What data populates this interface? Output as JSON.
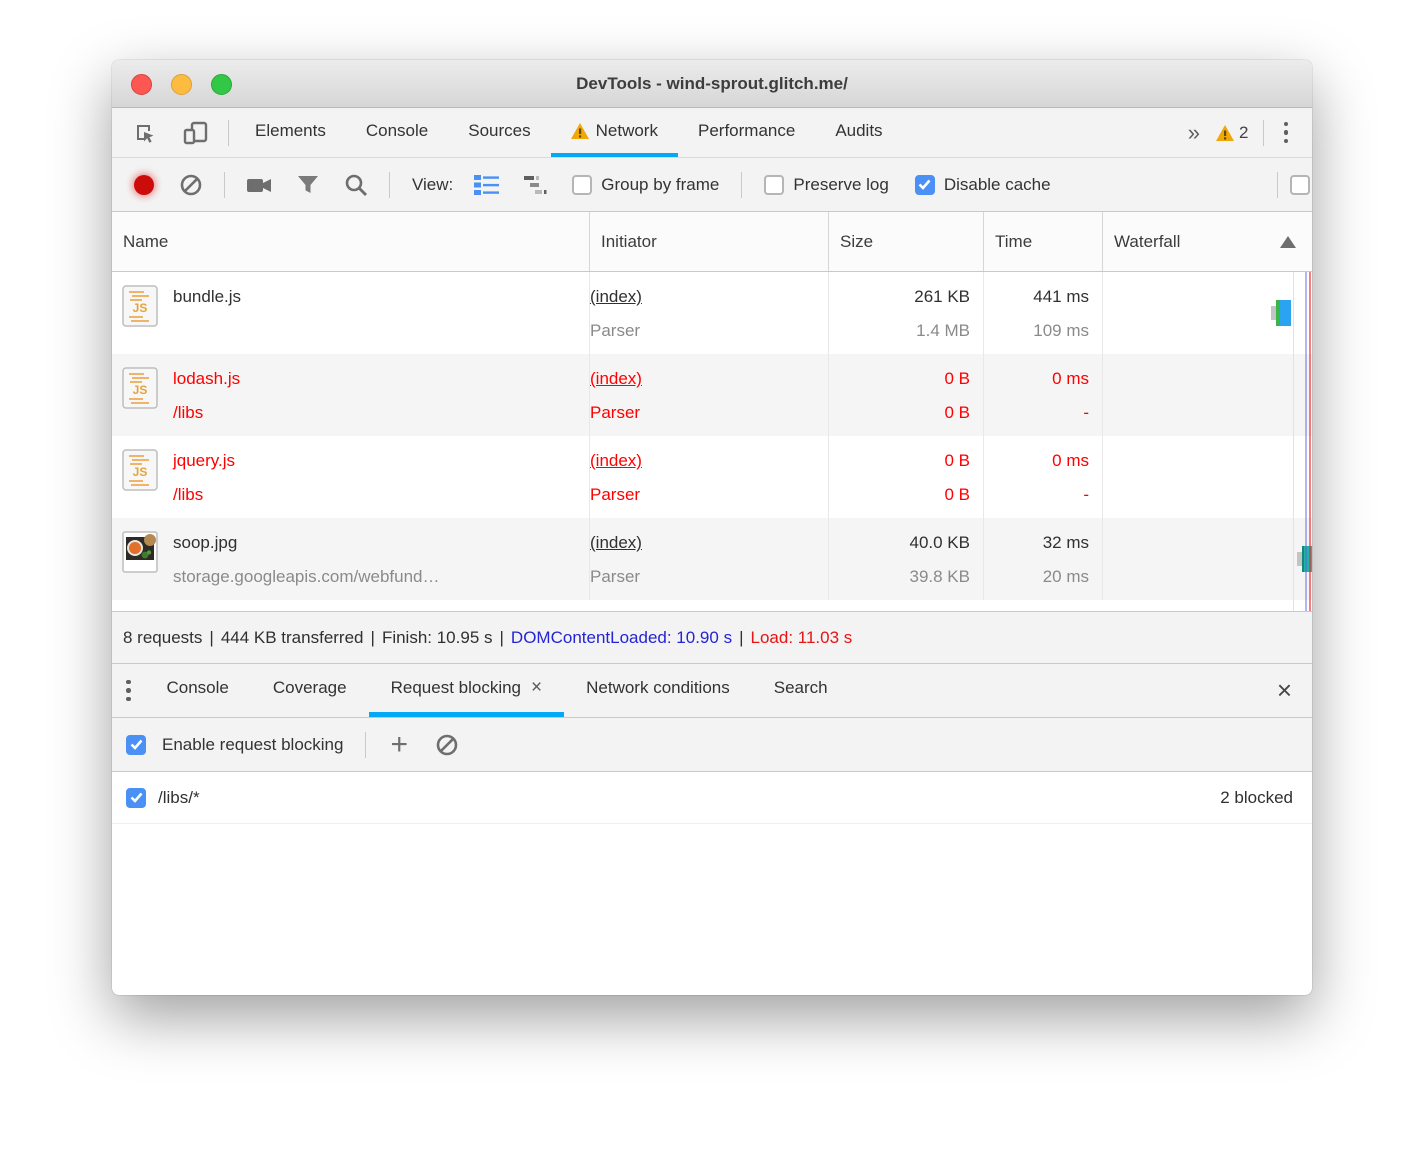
{
  "window_title": "DevTools - wind-sprout.glitch.me/",
  "main_tabs": {
    "elements": "Elements",
    "console": "Console",
    "sources": "Sources",
    "network": "Network",
    "performance": "Performance",
    "audits": "Audits",
    "warning_badge": "2"
  },
  "icons": {
    "overflow_chevron": "»",
    "close": "×",
    "add": "+",
    "kebab": "⋮"
  },
  "toolbar": {
    "view_label": "View:",
    "group_by_frame": "Group by frame",
    "preserve_log": "Preserve log",
    "disable_cache": "Disable cache"
  },
  "table": {
    "headers": {
      "name": "Name",
      "initiator": "Initiator",
      "size": "Size",
      "time": "Time",
      "waterfall": "Waterfall"
    },
    "rows": [
      {
        "name": "bundle.js",
        "subname": "",
        "initiator": "(index)",
        "initiator_sub": "Parser",
        "size": "261 KB",
        "size_sub": "1.4 MB",
        "time": "441 ms",
        "time_sub": "109 ms",
        "failed": false,
        "icon": "js-file"
      },
      {
        "name": "lodash.js",
        "subname": "/libs",
        "initiator": "(index)",
        "initiator_sub": "Parser",
        "size": "0 B",
        "size_sub": "0 B",
        "time": "0 ms",
        "time_sub": "-",
        "failed": true,
        "icon": "js-file"
      },
      {
        "name": "jquery.js",
        "subname": "/libs",
        "initiator": "(index)",
        "initiator_sub": "Parser",
        "size": "0 B",
        "size_sub": "0 B",
        "time": "0 ms",
        "time_sub": "-",
        "failed": true,
        "icon": "js-file"
      },
      {
        "name": "soop.jpg",
        "subname": "storage.googleapis.com/webfund…",
        "initiator": "(index)",
        "initiator_sub": "Parser",
        "size": "40.0 KB",
        "size_sub": "39.8 KB",
        "time": "32 ms",
        "time_sub": "20 ms",
        "failed": false,
        "icon": "image-file"
      }
    ]
  },
  "summary": {
    "requests": "8 requests",
    "transferred": "444 KB transferred",
    "finish": "Finish: 10.95 s",
    "dom_content_loaded": "DOMContentLoaded: 10.90 s",
    "load": "Load: 11.03 s",
    "separator": "|"
  },
  "drawer": {
    "console": "Console",
    "coverage": "Coverage",
    "request_blocking": "Request blocking",
    "network_conditions": "Network conditions",
    "search": "Search"
  },
  "blocking": {
    "enable_label": "Enable request blocking",
    "patterns": [
      {
        "pattern": "/libs/*",
        "blocked_count": "2 blocked",
        "checked": true
      }
    ]
  },
  "colors": {
    "accent_blue": "#03a9f4",
    "checkbox_blue": "#4a90f5",
    "error_red": "#ff0000",
    "dcl_blue": "#2424d6",
    "load_red": "#e81313",
    "warning_amber": "#f0a70a"
  }
}
